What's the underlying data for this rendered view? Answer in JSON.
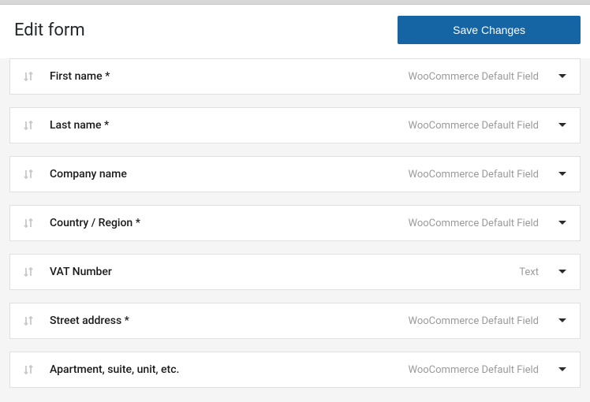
{
  "header": {
    "title": "Edit form",
    "save_label": "Save Changes"
  },
  "fields": [
    {
      "label": "First name *",
      "type": "WooCommerce Default Field"
    },
    {
      "label": "Last name *",
      "type": "WooCommerce Default Field"
    },
    {
      "label": "Company name",
      "type": "WooCommerce Default Field"
    },
    {
      "label": "Country / Region *",
      "type": "WooCommerce Default Field"
    },
    {
      "label": "VAT Number",
      "type": "Text"
    },
    {
      "label": "Street address *",
      "type": "WooCommerce Default Field"
    },
    {
      "label": "Apartment, suite, unit, etc.",
      "type": "WooCommerce Default Field"
    }
  ]
}
